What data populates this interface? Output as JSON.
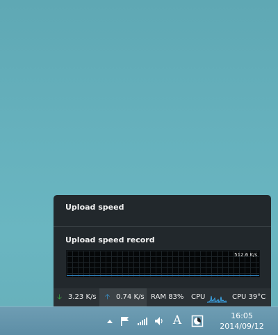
{
  "popup": {
    "title": "Upload speed",
    "record_title": "Upload speed record",
    "record_peak": "512.6 K/s"
  },
  "stats": {
    "download": "3.23 K/s",
    "upload": "0.74 K/s",
    "ram": "RAM 83%",
    "cpu": "CPU",
    "cpu_temp": "CPU 39°C"
  },
  "taskbar": {
    "tray_icons": [
      "show-hidden-icons-arrow-icon",
      "action-center-flag-icon",
      "network-signal-icon",
      "volume-icon",
      "input-language-icon",
      "app-tray-icon"
    ],
    "language": "A",
    "time": "16:05",
    "date": "2014/09/12"
  },
  "colors": {
    "download_arrow": "#3dbb3d",
    "upload_arrow": "#3aa0e0",
    "graph_line": "#2e7fb8",
    "panel_bg": "#22282c"
  }
}
